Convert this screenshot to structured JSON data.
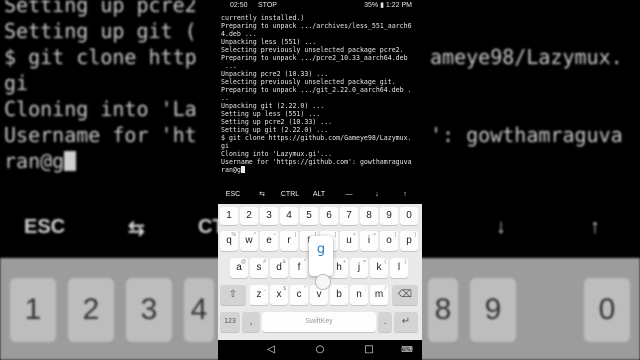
{
  "background": {
    "terminal_lines": [
      "Setting up pcre2",
      "Setting up git (",
      "$ git clone http",
      "gi",
      "Cloning into 'La",
      "Username for 'ht",
      "ran@g"
    ],
    "terminal_right_fragments": [
      "ameye98/Lazymux.",
      "': gowthamraguva"
    ],
    "extra_keys": [
      "ESC",
      "⇆",
      "CTRL",
      "↓",
      "↑"
    ],
    "number_keys": [
      "1",
      "2",
      "3",
      "4",
      "8",
      "9",
      "0"
    ]
  },
  "status_bar": {
    "time": "02:50",
    "indicator": "STOP",
    "battery": "35%",
    "clock": "1:22 PM"
  },
  "terminal": {
    "lines": [
      "currently installed.)",
      "Preparing to unpack .../archives/less_551_aarch6",
      "4.deb ...",
      "Unpacking less (551) ...",
      "Selecting previously unselected package pcre2.",
      "Preparing to unpack .../pcre2_10.33_aarch64.deb",
      " ...",
      "Unpacking pcre2 (10.33) ...",
      "Selecting previously unselected package git.",
      "Preparing to unpack .../git_2.22.0_aarch64.deb .",
      "..",
      "Unpacking git (2.22.0) ...",
      "Setting up less (551) ...",
      "Setting up pcre2 (10.33) ...",
      "Setting up git (2.22.0) ...",
      "$ git clone https://github.com/Gameye98/Lazymux.",
      "gi",
      "Cloning into 'Lazymux.gi'...",
      "Username for 'https://github.com': gowthamraguva",
      "ran@g"
    ]
  },
  "extra_keys": [
    "ESC",
    "⇆",
    "CTRL",
    "ALT",
    "—",
    "↓",
    "↑"
  ],
  "keyboard": {
    "number_row": [
      "1",
      "2",
      "3",
      "4",
      "5",
      "6",
      "7",
      "8",
      "9",
      "0"
    ],
    "row1": [
      {
        "key": "q",
        "sub": "%"
      },
      {
        "key": "w",
        "sub": "^"
      },
      {
        "key": "e",
        "sub": "~"
      },
      {
        "key": "r",
        "sub": "|"
      },
      {
        "key": "t",
        "sub": "["
      },
      {
        "key": "y",
        "sub": "]"
      },
      {
        "key": "u",
        "sub": "<"
      },
      {
        "key": "i",
        "sub": ">"
      },
      {
        "key": "o",
        "sub": "{"
      },
      {
        "key": "p",
        "sub": "}"
      }
    ],
    "pressed_key": "g",
    "row2": [
      {
        "key": "a",
        "sub": "@"
      },
      {
        "key": "s",
        "sub": "#"
      },
      {
        "key": "d",
        "sub": "&"
      },
      {
        "key": "f",
        "sub": "*"
      },
      {
        "key": "h",
        "sub": "+"
      },
      {
        "key": "j",
        "sub": "="
      },
      {
        "key": "k",
        "sub": "("
      },
      {
        "key": "l",
        "sub": ")"
      }
    ],
    "row3": [
      {
        "key": "z",
        "sub": "_"
      },
      {
        "key": "x",
        "sub": "$"
      },
      {
        "key": "c",
        "sub": "\""
      },
      {
        "key": "v",
        "sub": "'"
      },
      {
        "key": "b",
        "sub": ":"
      },
      {
        "key": "n",
        "sub": ";"
      },
      {
        "key": "m",
        "sub": "/"
      }
    ],
    "shift_key": "⇧",
    "backspace_key": "⌫",
    "symbols_key": "123",
    "comma_key": ",",
    "space_label": "SwiftKey",
    "period_key": ".",
    "enter_key": "↵"
  },
  "nav_bar": {
    "back": "◁",
    "home": "○",
    "recents": "□",
    "keyboard_hide": "⌨"
  }
}
